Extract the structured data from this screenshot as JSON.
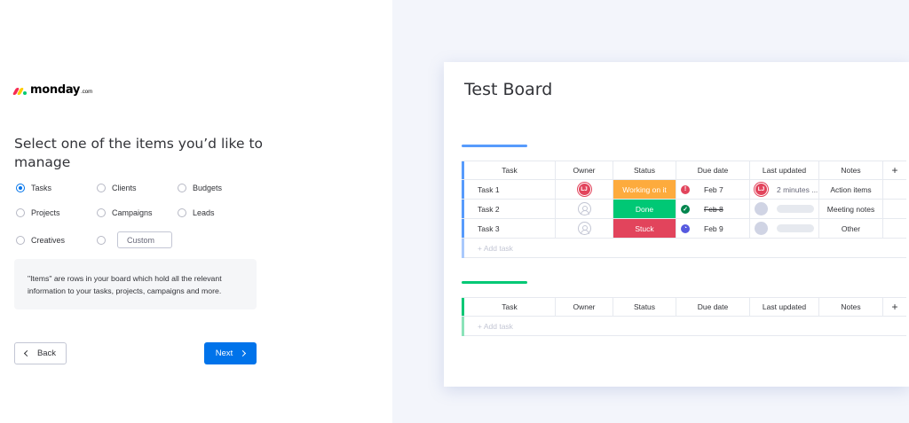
{
  "brand": {
    "name": "monday",
    "suffix": ".com"
  },
  "onboarding": {
    "title": "Select one of the items you’d like to manage",
    "options": [
      {
        "label": "Tasks",
        "selected": true
      },
      {
        "label": "Clients",
        "selected": false
      },
      {
        "label": "Budgets",
        "selected": false
      },
      {
        "label": "Projects",
        "selected": false
      },
      {
        "label": "Campaigns",
        "selected": false
      },
      {
        "label": "Leads",
        "selected": false
      },
      {
        "label": "Creatives",
        "selected": false
      }
    ],
    "custom_placeholder": "Custom",
    "info": "\"Items\" are rows in your board which hold all the relevant information to your tasks, projects, campaigns and more.",
    "back_label": "Back",
    "next_label": "Next"
  },
  "board": {
    "title": "Test Board",
    "columns": [
      "Task",
      "Owner",
      "Status",
      "Due date",
      "Last updated",
      "Notes"
    ],
    "add_column_label": "+",
    "group1": {
      "color": "#579bfc",
      "rows": [
        {
          "task": "Task 1",
          "owner": "LJ",
          "status": "Working on it",
          "status_color": "#fdab3d",
          "due": "Feb 7",
          "due_icon": "alert-icon",
          "due_icon_color": "#e2445c",
          "updated_avatar": "LJ",
          "updated": "2 minutes ...",
          "notes": "Action items"
        },
        {
          "task": "Task 2",
          "owner": "",
          "status": "Done",
          "status_color": "#00c875",
          "due": "Feb 8",
          "due_icon": "check-icon",
          "due_icon_color": "#00854d",
          "updated_avatar": "",
          "updated": "",
          "notes": "Meeting notes"
        },
        {
          "task": "Task 3",
          "owner": "",
          "status": "Stuck",
          "status_color": "#e2445c",
          "due": "Feb 9",
          "due_icon": "clock-icon",
          "due_icon_color": "#5559df",
          "updated_avatar": "",
          "updated": "",
          "notes": "Other"
        }
      ],
      "add_task": "+ Add task"
    },
    "group2": {
      "color": "#00c875",
      "rows": [],
      "add_task": "+ Add task"
    }
  }
}
